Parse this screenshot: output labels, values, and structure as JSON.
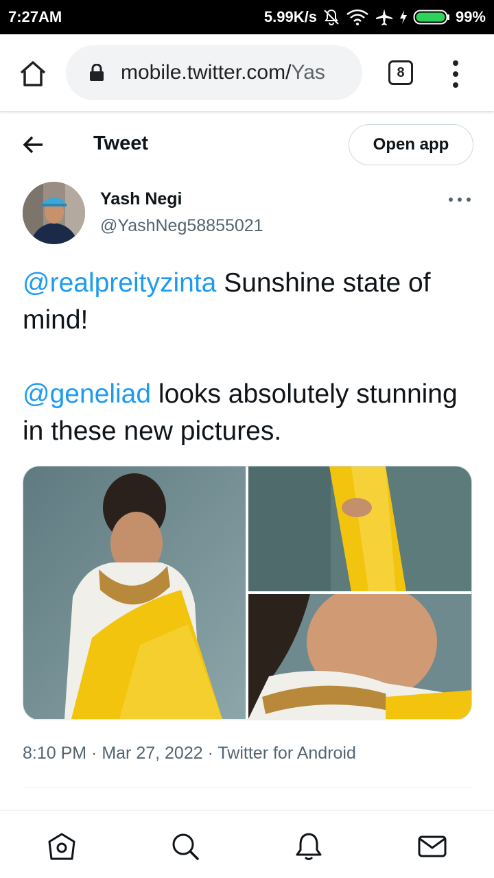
{
  "status_bar": {
    "time": "7:27AM",
    "network_speed": "5.99K/s",
    "battery": "99%",
    "icons": [
      "mute-icon",
      "wifi-icon",
      "airplane-icon",
      "charging-icon",
      "battery-icon"
    ]
  },
  "browser": {
    "url_host": "mobile.twitter.com/",
    "url_path": "Yas",
    "tab_count": "8",
    "icons": [
      "home-icon",
      "lock-icon",
      "tabs-icon",
      "menu-icon"
    ]
  },
  "header": {
    "title": "Tweet",
    "open_app_label": "Open app"
  },
  "tweet": {
    "author": {
      "display_name": "Yash Negi",
      "handle": "@YashNeg58855021"
    },
    "text": {
      "mention_1": "@realpreityzinta",
      "line_1_rest": " Sunshine state of mind!",
      "mention_2": "@geneliad",
      "line_2_rest": " looks absolutely stunning in these new pictures."
    },
    "media_count": 3,
    "meta": "8:10 PM · Mar 27, 2022 · Twitter for Android"
  },
  "colors": {
    "accent": "#1d9bf0",
    "text_primary": "#0f1419",
    "text_secondary": "#536471",
    "border": "#cfd9de"
  },
  "bottom_nav": {
    "icons": [
      "home-icon",
      "search-icon",
      "notifications-icon",
      "messages-icon"
    ]
  }
}
